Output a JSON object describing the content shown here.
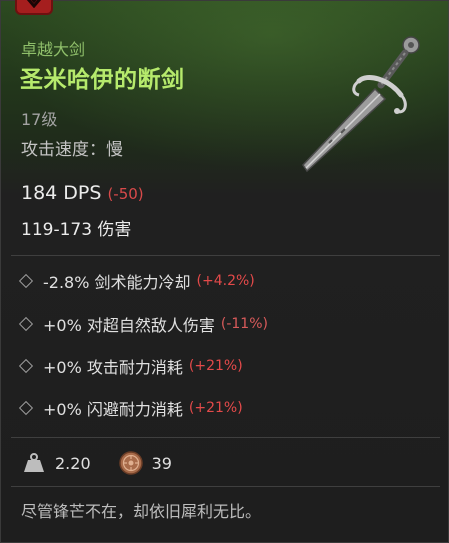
{
  "item": {
    "category": "卓越大剑",
    "name": "圣米哈伊的断剑",
    "level": "17级",
    "attack_speed": "攻击速度：慢",
    "dps": "184 DPS",
    "dps_delta": "(-50)",
    "damage": "119-173 伤害"
  },
  "stats": [
    {
      "value": "-2.8% 剑术能力冷却",
      "delta": "(+4.2%)"
    },
    {
      "value": "+0% 对超自然敌人伤害",
      "delta": "(-11%)"
    },
    {
      "value": "+0% 攻击耐力消耗",
      "delta": "(+21%)"
    },
    {
      "value": "+0% 闪避耐力消耗",
      "delta": "(+21%)"
    }
  ],
  "weight": "2.20",
  "price": "39",
  "flavor_text": "尽管锋芒不在，却依旧犀利无比。",
  "icons": {
    "badge": "down-arrow-icon",
    "stat_marker": "diamond-icon",
    "weight": "weight-icon",
    "currency": "coin-icon",
    "item_image": "sword-image"
  },
  "colors": {
    "item_name": "#b6ea6c",
    "category": "#8fbf6a",
    "negative_delta": "#d94a4a",
    "badge": "#a51e1e"
  }
}
